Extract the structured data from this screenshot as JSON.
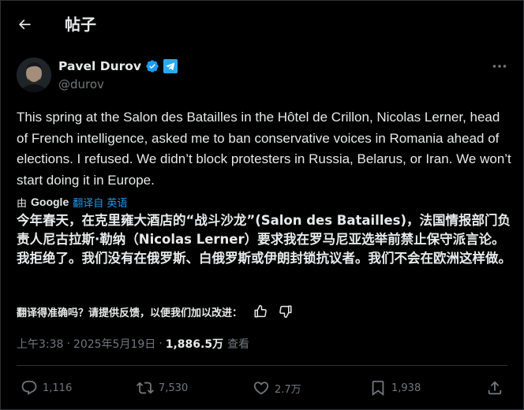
{
  "header": {
    "title": "帖子"
  },
  "author": {
    "name": "Pavel Durov",
    "handle": "@durov"
  },
  "post": {
    "text": "This spring at the Salon des Batailles in the Hôtel de Crillon, Nicolas Lerner, head of French intelligence, asked me to ban conservative voices in Romania ahead of elections. I refused. We didn’t block protesters in Russia, Belarus, or Iran. We won’t start doing it in Europe.",
    "translated_text": "今年春天，在克里雍大酒店的“战斗沙龙”(Salon des Batailles)，法国情报部门负责人尼古拉斯·勒纳（Nicolas Lerner）要求我在罗马尼亚选举前禁止保守派言论。我拒绝了。我们没有在俄罗斯、白俄罗斯或伊朗封锁抗议者。我们不会在欧洲这样做。"
  },
  "translation": {
    "by_label": "由",
    "provider": "Google",
    "link": "翻译自 英语",
    "feedback_prompt": "翻译得准确吗？请提供反馈，以便我们加以改进："
  },
  "meta": {
    "time": "上午3:38",
    "sep": "·",
    "date": "2025年5月19日",
    "views_count": "1,886.5万",
    "views_label": "查看"
  },
  "stats": {
    "replies": "1,116",
    "reposts": "7,530",
    "likes": "2.7万",
    "bookmarks": "1,938"
  },
  "colors": {
    "background": "#000000",
    "text": "#e7e9ea",
    "secondary": "#71767b",
    "accent": "#1d9bf0",
    "telegram": "#2aabee",
    "divider": "#2f3336"
  },
  "icons": [
    "back-arrow-icon",
    "verified-badge-icon",
    "telegram-icon",
    "more-icon",
    "thumbs-up-icon",
    "thumbs-down-icon",
    "reply-icon",
    "repost-icon",
    "like-icon",
    "bookmark-icon",
    "share-icon"
  ]
}
